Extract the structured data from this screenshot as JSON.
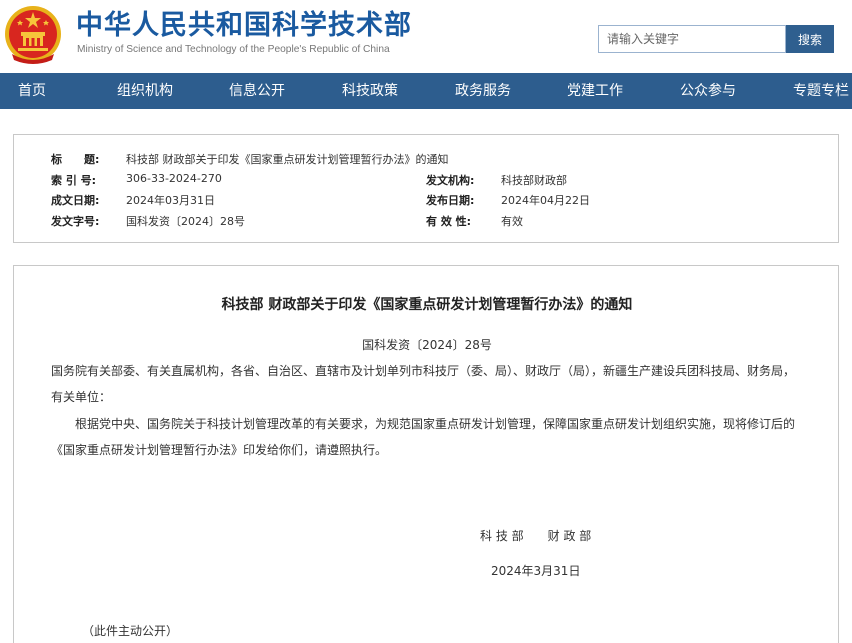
{
  "header": {
    "title": "中华人民共和国科学技术部",
    "subtitle": "Ministry of Science and Technology of the People's Republic of China",
    "search_placeholder": "请输入关键字",
    "search_button": "搜索"
  },
  "nav": {
    "items": [
      {
        "label": "首页"
      },
      {
        "label": "组织机构"
      },
      {
        "label": "信息公开"
      },
      {
        "label": "科技政策"
      },
      {
        "label": "政务服务"
      },
      {
        "label": "党建工作"
      },
      {
        "label": "公众参与"
      },
      {
        "label": "专题专栏"
      }
    ]
  },
  "meta": {
    "title_label": "标　　题:",
    "title_value": "科技部 财政部关于印发《国家重点研发计划管理暂行办法》的通知",
    "index_label": "索 引 号:",
    "index_value": "306-33-2024-270",
    "issuer_label": "发文机构:",
    "issuer_value": "科技部财政部",
    "created_label": "成文日期:",
    "created_value": "2024年03月31日",
    "published_label": "发布日期:",
    "published_value": "2024年04月22日",
    "docno_label": "发文字号:",
    "docno_value": "国科发资〔2024〕28号",
    "validity_label": "有 效 性:",
    "validity_value": "有效"
  },
  "article": {
    "title": "科技部 财政部关于印发《国家重点研发计划管理暂行办法》的通知",
    "doc_number": "国科发资〔2024〕28号",
    "recipients": "国务院有关部委、有关直属机构，各省、自治区、直辖市及计划单列市科技厅（委、局）、财政厅（局），新疆生产建设兵团科技局、财务局，有关单位：",
    "body": "根据党中央、国务院关于科技计划管理改革的有关要求，为规范国家重点研发计划管理，保障国家重点研发计划组织实施，现将修订后的《国家重点研发计划管理暂行办法》印发给你们，请遵照执行。",
    "signers": "科 技 部　　财 政 部",
    "date": "2024年3月31日",
    "public_note": "（此件主动公开）"
  },
  "colors": {
    "brand_blue": "#1a5aa0",
    "nav_bg": "#2d5d8e",
    "border": "#c8c8c8"
  }
}
